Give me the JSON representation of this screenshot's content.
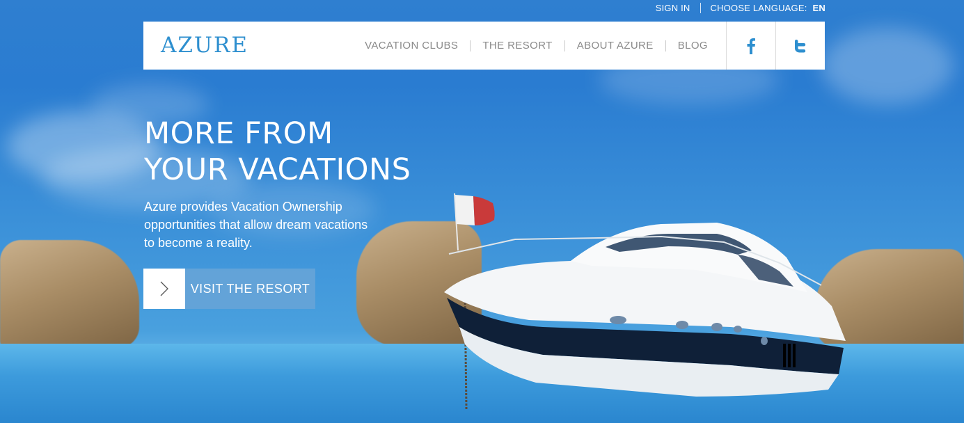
{
  "utility": {
    "sign_in": "SIGN IN",
    "language_label": "CHOOSE LANGUAGE:",
    "language_code": "EN"
  },
  "header": {
    "logo": "AZURE",
    "nav": [
      {
        "label": "VACATION CLUBS"
      },
      {
        "label": "THE RESORT"
      },
      {
        "label": "ABOUT AZURE"
      },
      {
        "label": "BLOG"
      }
    ],
    "social": [
      {
        "icon": "facebook-icon"
      },
      {
        "icon": "twitter-icon"
      }
    ]
  },
  "hero": {
    "headline_line1": "MORE FROM",
    "headline_line2": "YOUR VACATIONS",
    "subtext": "Azure provides Vacation Ownership opportunities that allow dream vacations to become a reality.",
    "cta_label": "VISIT THE RESORT",
    "cta_icon": "chevron-right-icon"
  },
  "colors": {
    "brand": "#2e8fcf",
    "nav_text": "#8a8a8a",
    "sky": "#2f7fd0",
    "cta_bg": "#68a5d7"
  }
}
